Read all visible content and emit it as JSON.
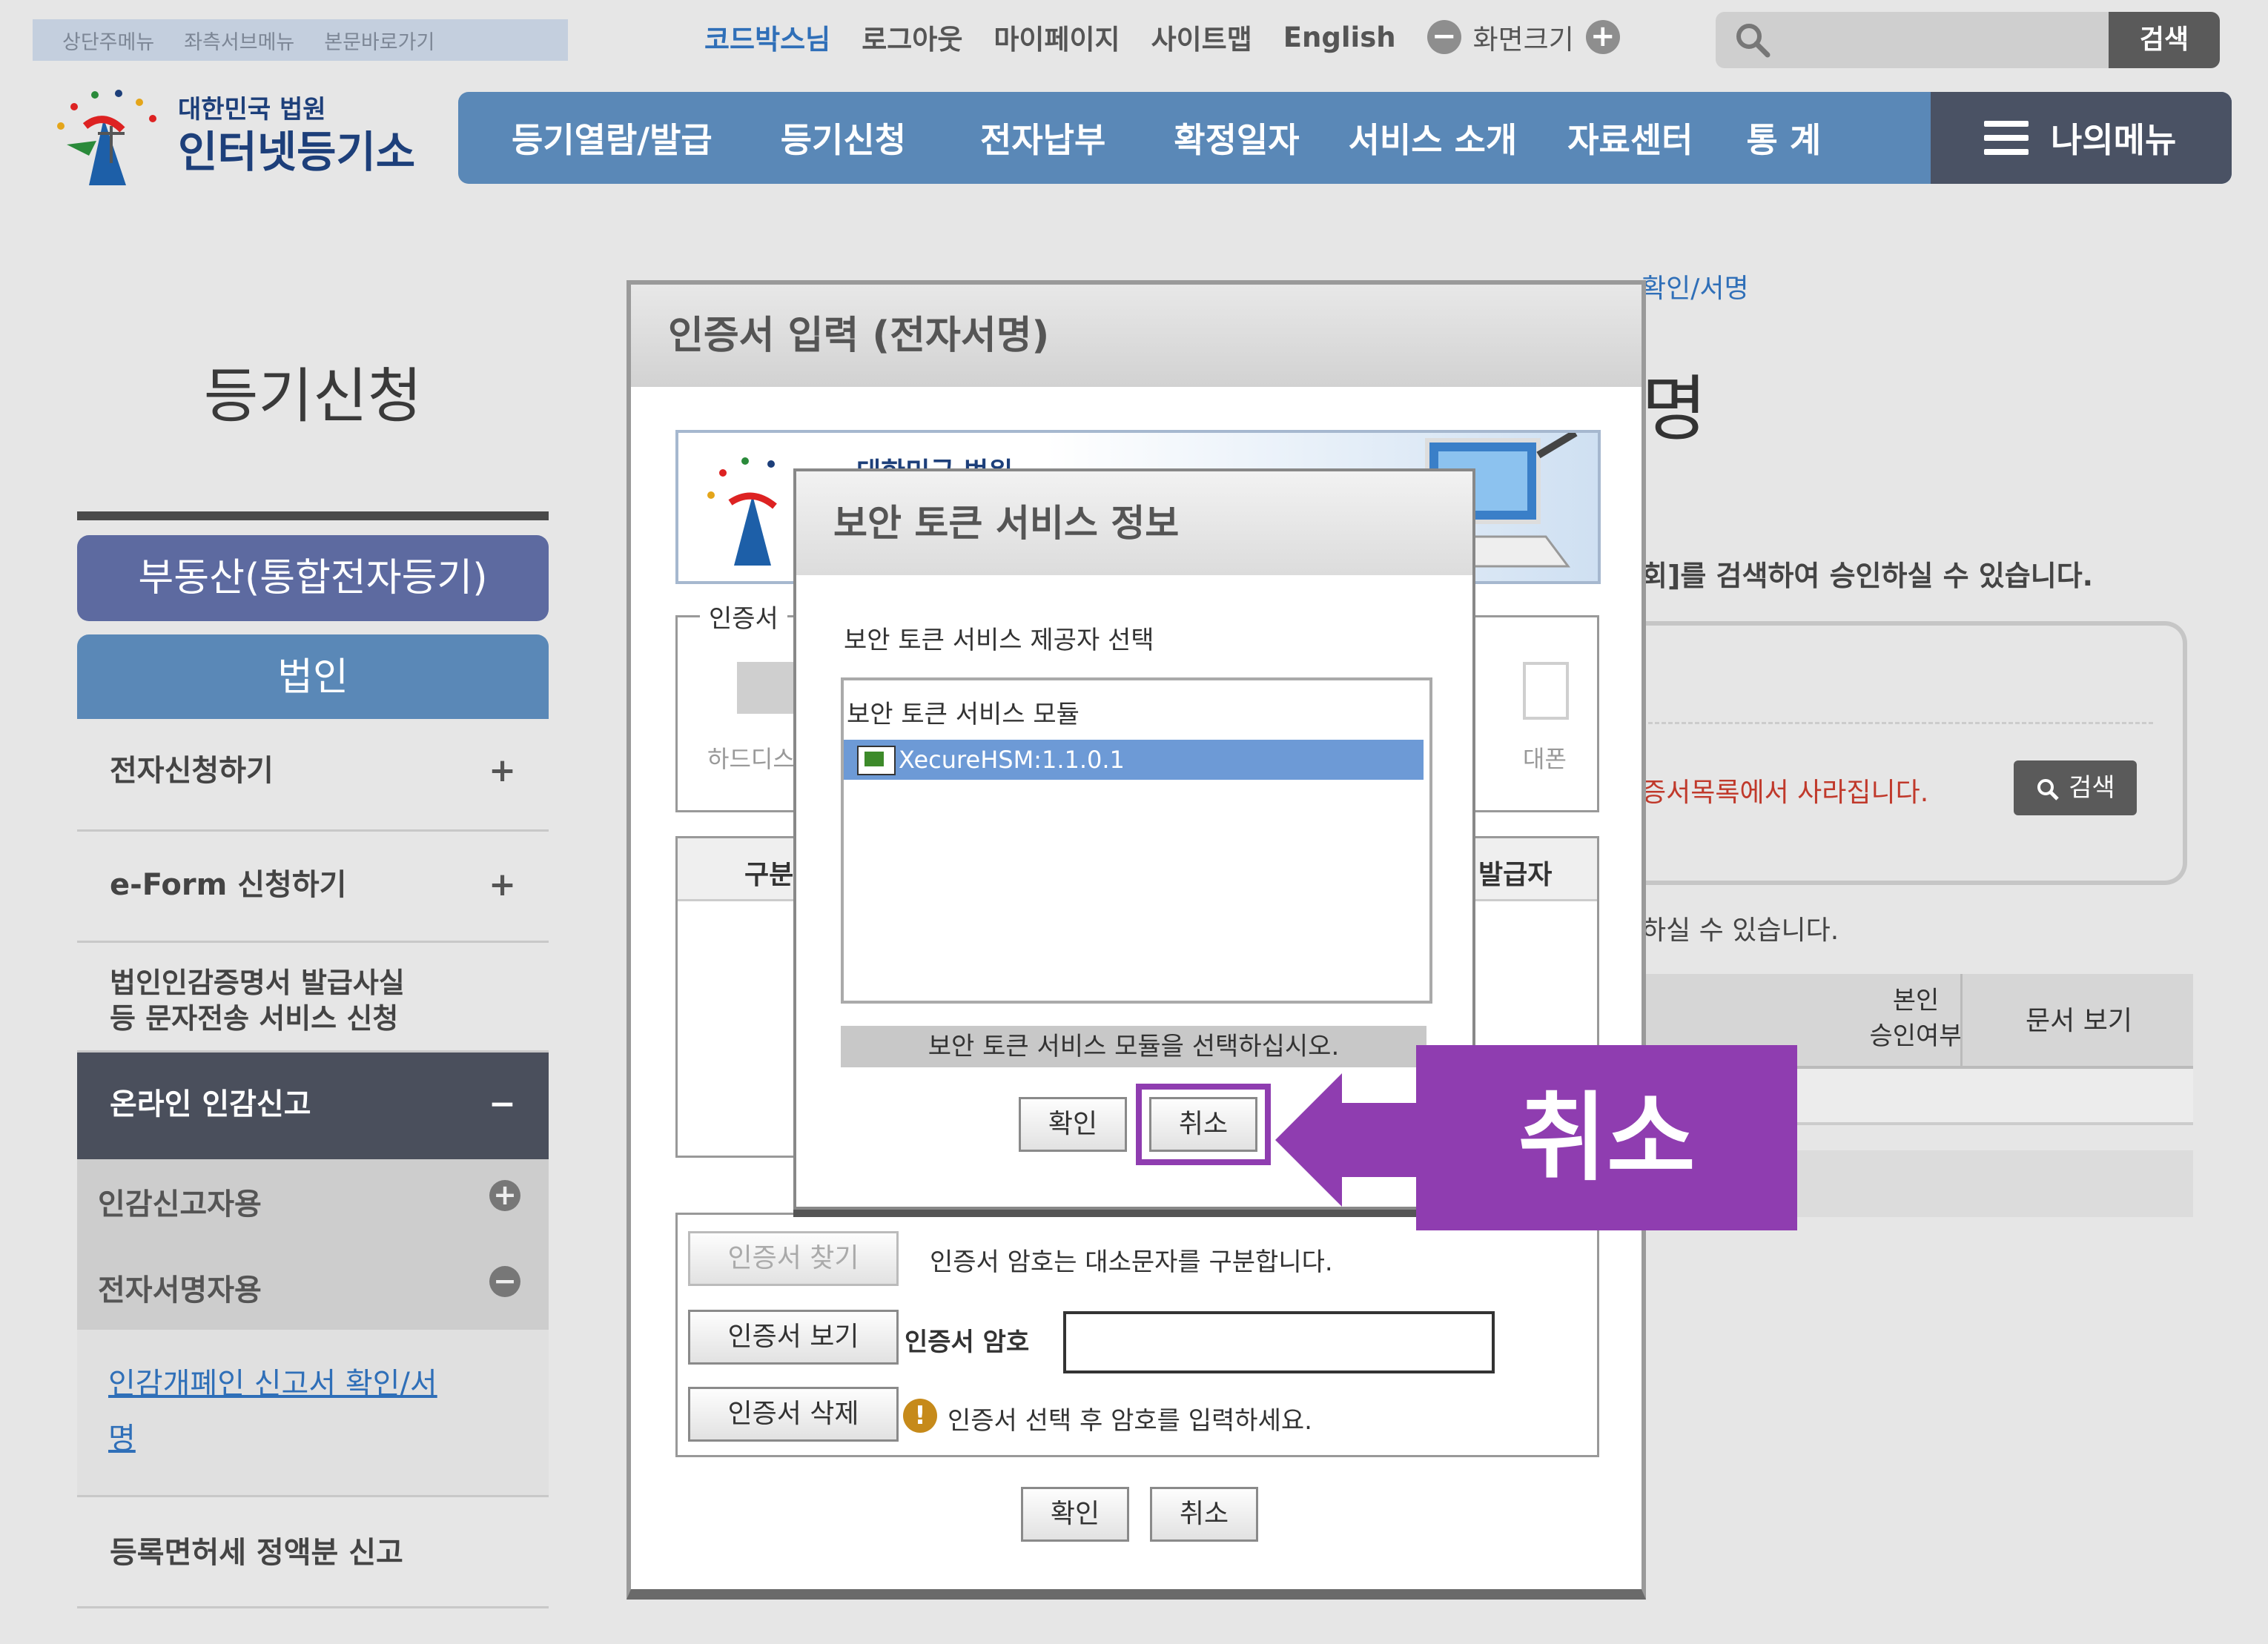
{
  "skip_links": [
    "상단주메뉴",
    "좌측서브메뉴",
    "본문바로가기"
  ],
  "util": {
    "user": "코드박스님",
    "logout": "로그아웃",
    "mypage": "마이페이지",
    "sitemap": "사이트맵",
    "english": "English",
    "zoom_label": "화면크기",
    "search_button": "검색"
  },
  "logo": {
    "line1": "대한민국 법원",
    "line2": "인터넷등기소"
  },
  "nav": {
    "items": [
      "등기열람/발급",
      "등기신청",
      "전자납부",
      "확정일자",
      "서비스 소개",
      "자료센터",
      "통 계"
    ],
    "my_menu": "나의메뉴"
  },
  "sidebar": {
    "title": "등기신청",
    "btn_realestate": "부동산(통합전자등기)",
    "btn_corp": "법인",
    "items": [
      "전자신청하기",
      "e-Form 신청하기",
      "법인인감증명서 발급사실\n등 문자전송 서비스 신청",
      "온라인 인감신고",
      "인감신고자용",
      "전자서명자용",
      "인감개폐인 신고서 확인/서\n명",
      "등록면허세 정액분 신고"
    ]
  },
  "background": {
    "breadcrumb_tail": "확인/서명",
    "title_tail": "명",
    "info_text": "회]를 검색하여 승인하실 수 있습니다.",
    "warn_text": "증서목록에서 사라집니다.",
    "search_btn": "검색",
    "note_text": "하실 수 있습니다.",
    "col_approval": "본인\n승인여부",
    "col_doc": "문서 보기"
  },
  "dialog_cert": {
    "title": "인증서 입력 (전자서명)",
    "banner_text": "대한민국 법원",
    "storage_legend": "인증서",
    "storage_harddisk": "하드디스",
    "storage_phone": "대폰",
    "col_type": "구분",
    "col_issuer": "발급자",
    "btn_find": "인증서 찾기",
    "btn_view": "인증서 보기",
    "btn_delete": "인증서 삭제",
    "case_note": "인증서 암호는 대소문자를 구분합니다.",
    "password_label": "인증서 암호",
    "password_value": "",
    "hint": "인증서 선택 후 암호를 입력하세요.",
    "ok": "확인",
    "cancel": "취소"
  },
  "dialog_token": {
    "title": "보안 토큰 서비스 정보",
    "subtitle": "보안 토큰 서비스 제공자 선택",
    "list_header": "보안 토큰 서비스 모듈",
    "list_items": [
      "XecureHSM:1.1.0.1"
    ],
    "status": "보안 토큰 서비스 모듈을 선택하십시오.",
    "ok": "확인",
    "cancel": "취소"
  },
  "callout": {
    "label": "취소",
    "color": "#8f3db0"
  }
}
